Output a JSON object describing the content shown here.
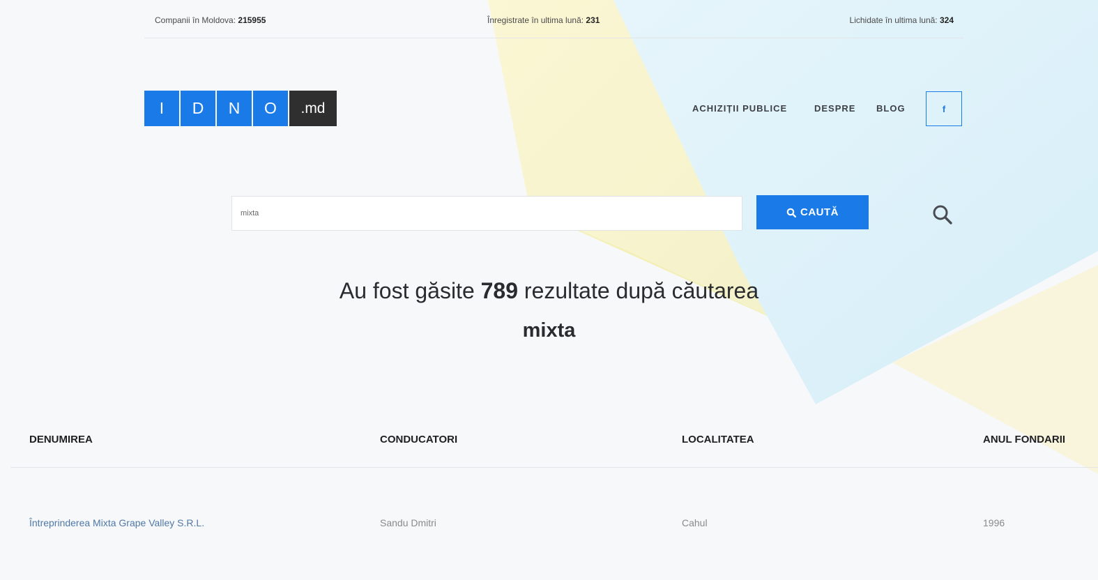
{
  "stats": {
    "companies_label": "Companii în Moldova:",
    "companies_value": "215955",
    "registered_label": "Înregistrate în ultima lună:",
    "registered_value": "231",
    "liquidated_label": "Lichidate în ultima lună:",
    "liquidated_value": "324"
  },
  "logo": {
    "letters": [
      "I",
      "D",
      "N",
      "O"
    ],
    "suffix": ".md"
  },
  "nav": {
    "items": [
      "ACHIZIȚII PUBLICE",
      "DESPRE",
      "BLOG"
    ],
    "facebook": "f"
  },
  "search": {
    "value": "mixta",
    "button_label": "CAUTĂ"
  },
  "results": {
    "prefix": "Au fost găsite",
    "count": "789",
    "suffix": "rezultate după căutarea",
    "query": "mixta"
  },
  "table": {
    "headers": [
      "DENUMIREA",
      "CONDUCATORI",
      "LOCALITATEA",
      "ANUL FONDARII"
    ],
    "rows": [
      [
        "Întreprinderea Mixta Grape Valley S.R.L.",
        "Sandu Dmitri",
        "Cahul",
        "1996"
      ]
    ]
  },
  "colors": {
    "accent": "#1a7be8",
    "logo_dark": "#2f2f30",
    "link": "#4f78a7"
  }
}
